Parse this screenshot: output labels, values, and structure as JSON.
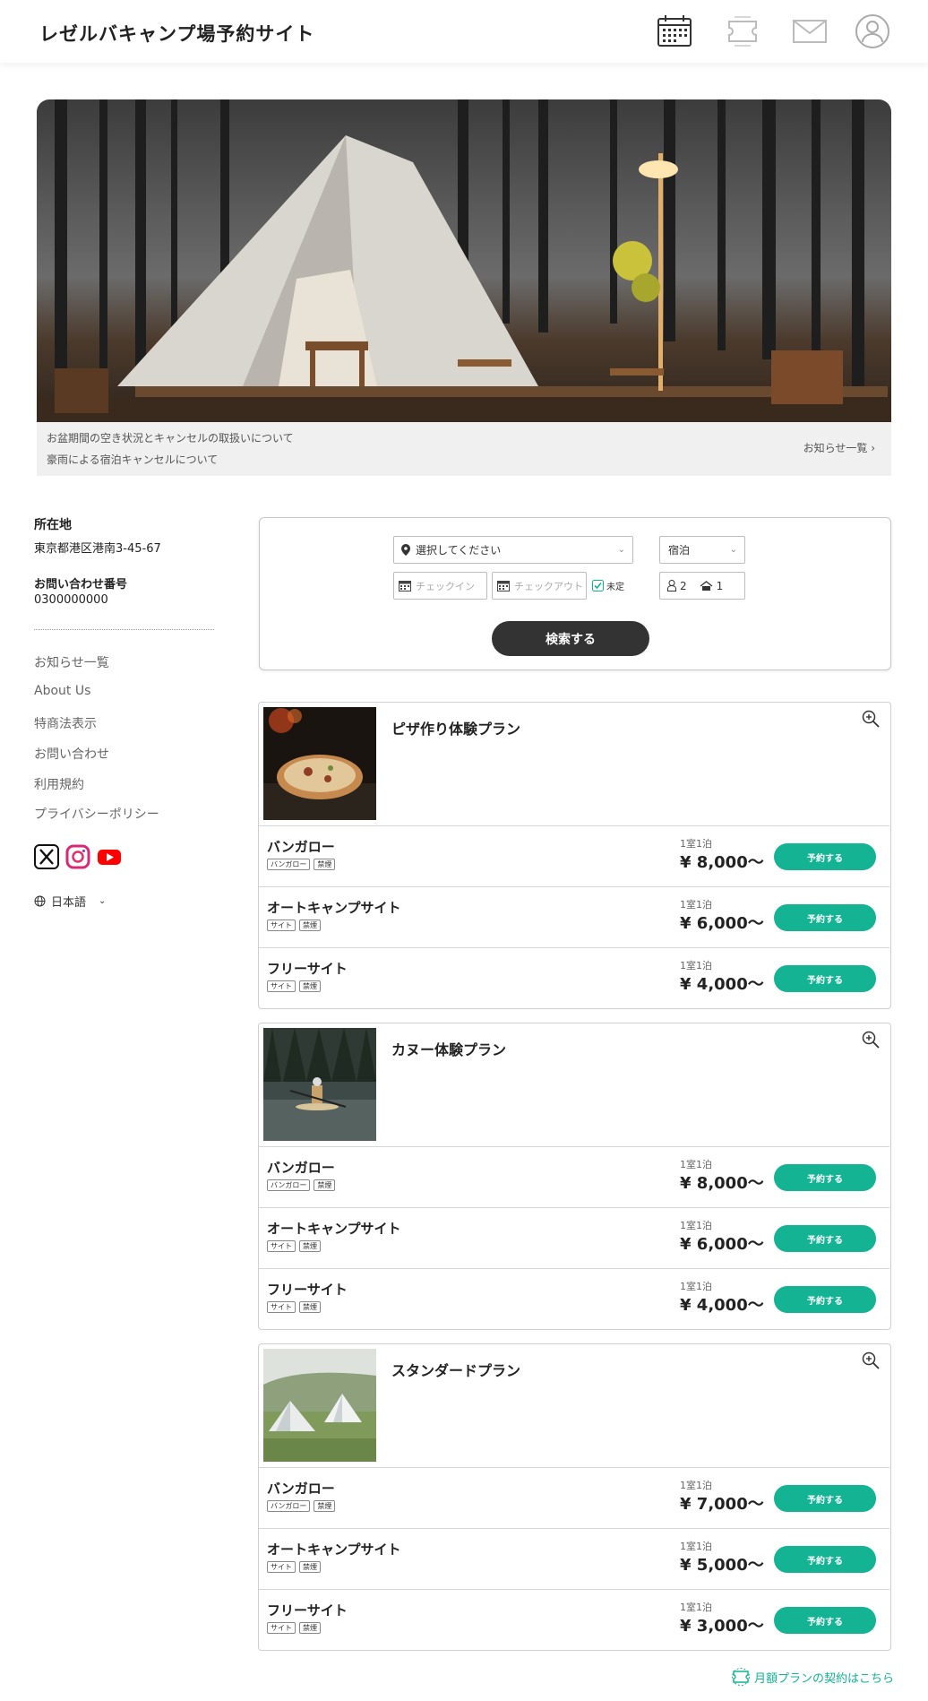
{
  "header": {
    "title": "レゼルバキャンプ場予約サイト",
    "icons": [
      "calendar-icon",
      "ticket-icon",
      "mail-icon",
      "user-icon"
    ]
  },
  "news": {
    "items": [
      "お盆期間の空き状況とキャンセルの取扱いについて",
      "豪雨による宿泊キャンセルについて"
    ],
    "all_link": "お知らせ一覧 ›"
  },
  "sidebar": {
    "address_label": "所在地",
    "address": "東京都港区港南3-45-67",
    "phone_label": "お問い合わせ番号",
    "phone": "0300000000",
    "links": [
      "お知らせ一覧",
      "About Us",
      "特商法表示",
      "お問い合わせ",
      "利用規約",
      "プライバシーポリシー"
    ],
    "language": "日本語"
  },
  "search": {
    "location_placeholder": "選択してください",
    "stay_type": "宿泊",
    "checkin_placeholder": "チェックイン",
    "checkout_placeholder": "チェックアウト",
    "undecided_label": "未定",
    "undecided_checked": true,
    "adults": "2",
    "rooms": "1",
    "button": "検索する"
  },
  "plans": [
    {
      "title": "ピザ作り体験プラン",
      "rooms": [
        {
          "name": "バンガロー",
          "tags": [
            "バンガロー",
            "禁煙"
          ],
          "per": "1室1泊",
          "price": "¥ 8,000〜",
          "button": "予約する"
        },
        {
          "name": "オートキャンプサイト",
          "tags": [
            "サイト",
            "禁煙"
          ],
          "per": "1室1泊",
          "price": "¥ 6,000〜",
          "button": "予約する"
        },
        {
          "name": "フリーサイト",
          "tags": [
            "サイト",
            "禁煙"
          ],
          "per": "1室1泊",
          "price": "¥ 4,000〜",
          "button": "予約する"
        }
      ]
    },
    {
      "title": "カヌー体験プラン",
      "rooms": [
        {
          "name": "バンガロー",
          "tags": [
            "バンガロー",
            "禁煙"
          ],
          "per": "1室1泊",
          "price": "¥ 8,000〜",
          "button": "予約する"
        },
        {
          "name": "オートキャンプサイト",
          "tags": [
            "サイト",
            "禁煙"
          ],
          "per": "1室1泊",
          "price": "¥ 6,000〜",
          "button": "予約する"
        },
        {
          "name": "フリーサイト",
          "tags": [
            "サイト",
            "禁煙"
          ],
          "per": "1室1泊",
          "price": "¥ 4,000〜",
          "button": "予約する"
        }
      ]
    },
    {
      "title": "スタンダードプラン",
      "rooms": [
        {
          "name": "バンガロー",
          "tags": [
            "バンガロー",
            "禁煙"
          ],
          "per": "1室1泊",
          "price": "¥ 7,000〜",
          "button": "予約する"
        },
        {
          "name": "オートキャンプサイト",
          "tags": [
            "サイト",
            "禁煙"
          ],
          "per": "1室1泊",
          "price": "¥ 5,000〜",
          "button": "予約する"
        },
        {
          "name": "フリーサイト",
          "tags": [
            "サイト",
            "禁煙"
          ],
          "per": "1室1泊",
          "price": "¥ 3,000〜",
          "button": "予約する"
        }
      ]
    }
  ],
  "footer": {
    "monthly_link": "月額プランの契約はこちら"
  },
  "colors": {
    "accent": "#13b394",
    "dark_button": "#333333"
  }
}
